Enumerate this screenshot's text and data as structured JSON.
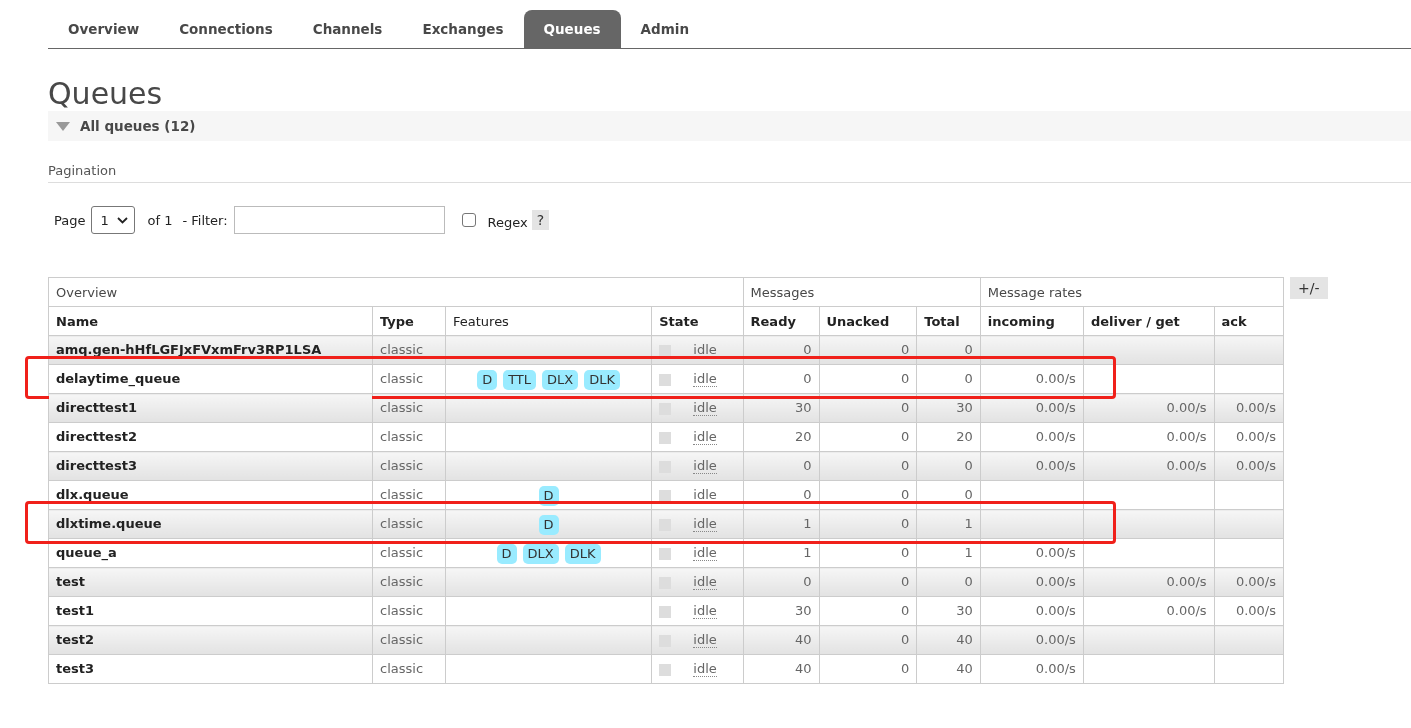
{
  "tabs": [
    {
      "label": "Overview",
      "selected": false
    },
    {
      "label": "Connections",
      "selected": false
    },
    {
      "label": "Channels",
      "selected": false
    },
    {
      "label": "Exchanges",
      "selected": false
    },
    {
      "label": "Queues",
      "selected": true
    },
    {
      "label": "Admin",
      "selected": false
    }
  ],
  "heading": "Queues",
  "section": {
    "title": "All queues (12)",
    "expanded": true
  },
  "pagination": {
    "title": "Pagination",
    "page_label": "Page",
    "page_value": "1",
    "of_text": "of 1",
    "filter_label": "- Filter:",
    "regex": {
      "label": "Regex",
      "checked": false
    },
    "help": "?"
  },
  "table": {
    "groups": [
      "Overview",
      "Messages",
      "Message rates"
    ],
    "columns": [
      "Name",
      "Type",
      "Features",
      "State",
      "Ready",
      "Unacked",
      "Total",
      "incoming",
      "deliver / get",
      "ack"
    ],
    "toggle": "+/-",
    "rows": [
      {
        "name": "amq.gen-hHfLGFJxFVxmFrv3RP1LSA",
        "type": "classic",
        "features": [],
        "state": "idle",
        "ready": "0",
        "unacked": "0",
        "total": "0",
        "highlighted": false
      },
      {
        "name": "delaytime_queue",
        "type": "classic",
        "features": [
          "D",
          "TTL",
          "DLX",
          "DLK"
        ],
        "state": "idle",
        "ready": "0",
        "unacked": "0",
        "total": "0",
        "incoming": "0.00/s",
        "highlighted": true
      },
      {
        "name": "directtest1",
        "type": "classic",
        "features": [],
        "state": "idle",
        "ready": "30",
        "unacked": "0",
        "total": "30",
        "incoming": "0.00/s",
        "deliver_get": "0.00/s",
        "ack": "0.00/s",
        "highlighted": false
      },
      {
        "name": "directtest2",
        "type": "classic",
        "features": [],
        "state": "idle",
        "ready": "20",
        "unacked": "0",
        "total": "20",
        "incoming": "0.00/s",
        "deliver_get": "0.00/s",
        "ack": "0.00/s",
        "highlighted": false
      },
      {
        "name": "directtest3",
        "type": "classic",
        "features": [],
        "state": "idle",
        "ready": "0",
        "unacked": "0",
        "total": "0",
        "incoming": "0.00/s",
        "deliver_get": "0.00/s",
        "ack": "0.00/s",
        "highlighted": false
      },
      {
        "name": "dlx.queue",
        "type": "classic",
        "features": [
          "D"
        ],
        "state": "idle",
        "ready": "0",
        "unacked": "0",
        "total": "0",
        "highlighted": false
      },
      {
        "name": "dlxtime.queue",
        "type": "classic",
        "features": [
          "D"
        ],
        "state": "idle",
        "ready": "1",
        "unacked": "0",
        "total": "1",
        "highlighted": true
      },
      {
        "name": "queue_a",
        "type": "classic",
        "features": [
          "D",
          "DLX",
          "DLK"
        ],
        "state": "idle",
        "ready": "1",
        "unacked": "0",
        "total": "1",
        "incoming": "0.00/s",
        "highlighted": false
      },
      {
        "name": "test",
        "type": "classic",
        "features": [],
        "state": "idle",
        "ready": "0",
        "unacked": "0",
        "total": "0",
        "incoming": "0.00/s",
        "deliver_get": "0.00/s",
        "ack": "0.00/s",
        "highlighted": false
      },
      {
        "name": "test1",
        "type": "classic",
        "features": [],
        "state": "idle",
        "ready": "30",
        "unacked": "0",
        "total": "30",
        "incoming": "0.00/s",
        "deliver_get": "0.00/s",
        "ack": "0.00/s",
        "highlighted": false
      },
      {
        "name": "test2",
        "type": "classic",
        "features": [],
        "state": "idle",
        "ready": "40",
        "unacked": "0",
        "total": "40",
        "incoming": "0.00/s",
        "highlighted": false
      },
      {
        "name": "test3",
        "type": "classic",
        "features": [],
        "state": "idle",
        "ready": "40",
        "unacked": "0",
        "total": "40",
        "incoming": "0.00/s",
        "highlighted": false
      }
    ]
  }
}
